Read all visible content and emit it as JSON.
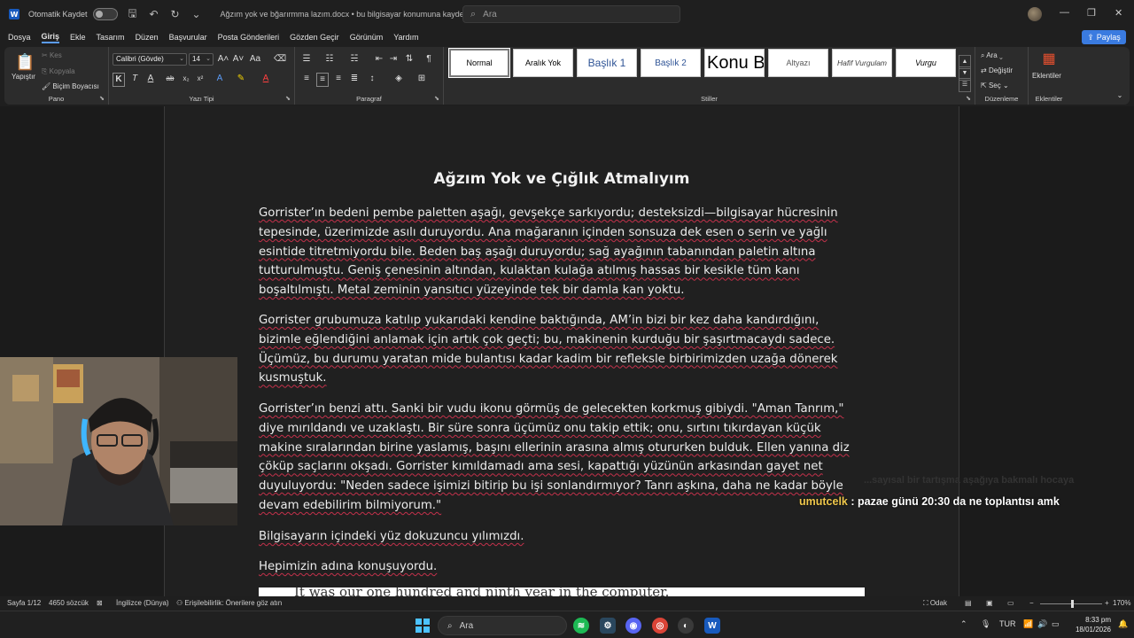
{
  "titlebar": {
    "autosave_label": "Otomatik Kaydet",
    "doc_title": "Ağzım yok  ve bğarırmma lazım.docx  •  bu bilgisayar konumuna kaydedildi  ⌄",
    "search_placeholder": "Ara"
  },
  "menu": {
    "items": [
      "Dosya",
      "Giriş",
      "Ekle",
      "Tasarım",
      "Düzen",
      "Başvurular",
      "Posta Gönderileri",
      "Gözden Geçir",
      "Görünüm",
      "Yardım"
    ],
    "share_label": "Paylaş"
  },
  "ribbon": {
    "pano": {
      "paste_label": "Yapıştır",
      "cut_label": "Kes",
      "copy_label": "Kopyala",
      "format_painter_label": "Biçim Boyacısı",
      "group_label": "Pano"
    },
    "font": {
      "font_name": "Calibri (Gövde)",
      "font_size": "14",
      "group_label": "Yazı Tipi"
    },
    "paragraph": {
      "group_label": "Paragraf"
    },
    "styles": {
      "group_label": "Stiller",
      "items": [
        "Normal",
        "Aralık Yok",
        "Başlık 1",
        "Başlık 2",
        "Konu B",
        "Altyazı",
        "Hafif Vurgulam",
        "Vurgu"
      ]
    },
    "editing": {
      "find_label": "Ara",
      "replace_label": "Değiştir",
      "select_label": "Seç",
      "group_label": "Düzenleme"
    },
    "addins": {
      "button_label": "Eklentiler",
      "group_label": "Eklentiler"
    }
  },
  "document": {
    "heading": "Ağzım Yok ve Çığlık Atmalıyım",
    "paragraphs": [
      {
        "lines": [
          "Gorrister’ın bedeni pembe paletten aşağı, gevşekçe sarkıyordu; desteksizdi—bilgisayar hücresinin",
          "tepesinde, üzerimizde asılı duruyordu. Ana mağaranın içinden sonsuza dek esen o serin ve yağlı",
          "esintide titretmiyordu bile. Beden baş aşağı duruyordu; sağ ayağının tabanından paletin altına",
          "tutturulmuştu. Geniş çenesinin altından, kulaktan kulağa atılmış hassas bir kesikle tüm kanı",
          "boşaltılmıştı. Metal zeminin yansıtıcı yüzeyinde tek bir damla kan yoktu."
        ]
      },
      {
        "lines": [
          "Gorrister grubumuza katılıp yukarıdaki kendine baktığında, AM’in bizi bir kez daha kandırdığını,",
          "bizimle eğlendiğini anlamak için artık çok geçti; bu, makinenin kurduğu bir şaşırtmacaydı sadece.",
          "Üçümüz, bu durumu yaratan mide bulantısı kadar kadim bir refleksle birbirimizden uzağa dönerek",
          "kusmuştuk."
        ]
      },
      {
        "lines": [
          "Gorrister’ın benzi attı. Sanki bir vudu ikonu görmüş de gelecekten korkmuş gibiydi. \"Aman Tanrım,\"",
          "diye mırıldandı ve uzaklaştı. Bir süre sonra üçümüz onu takip ettik; onu, sırtını tıkırdayan küçük",
          "makine sıralarından birine yaslamış, başını ellerinin arasına almış otururken bulduk. Ellen yanına diz",
          "çöküp saçlarını okşadı. Gorrister kımıldamadı ama sesi, kapattığı yüzünün arkasından gayet net",
          "duyuluyordu: \"Neden sadece işimizi bitirip bu işi sonlandırmıyor? Tanrı aşkına, daha ne kadar böyle",
          "devam edebilirim bilmiyorum.\""
        ]
      },
      {
        "lines": [
          "Bilgisayarın içindeki yüz dokuzuncu yılımızdı."
        ]
      },
      {
        "lines": [
          "Hepimizin adına konuşuyordu."
        ]
      }
    ],
    "embedded_image_text": "It was our one hundred and ninth year in the computer."
  },
  "chat": {
    "ghost_text": "...sayısal bir tartışma aşağıya bakmalı hocaya",
    "username": "umutcelk",
    "message": " : pazae günü 20:30 da ne toplantısı amk"
  },
  "statusbar": {
    "page": "Sayfa 1/12",
    "words": "4650 sözcük",
    "language": "İngilizce (Dünya)",
    "accessibility": "Erişilebilirlik: Önerilere göz atın",
    "focus": "Odak",
    "zoom": "170%"
  },
  "taskbar": {
    "search_placeholder": "Ara",
    "language": "TUR",
    "time": "8:33 pm",
    "date": "18/01/2026"
  },
  "colors": {
    "accent": "#185abd",
    "share": "#3a7be0",
    "spell_underline": "#c4314b",
    "chat_username": "#f0c84c"
  }
}
